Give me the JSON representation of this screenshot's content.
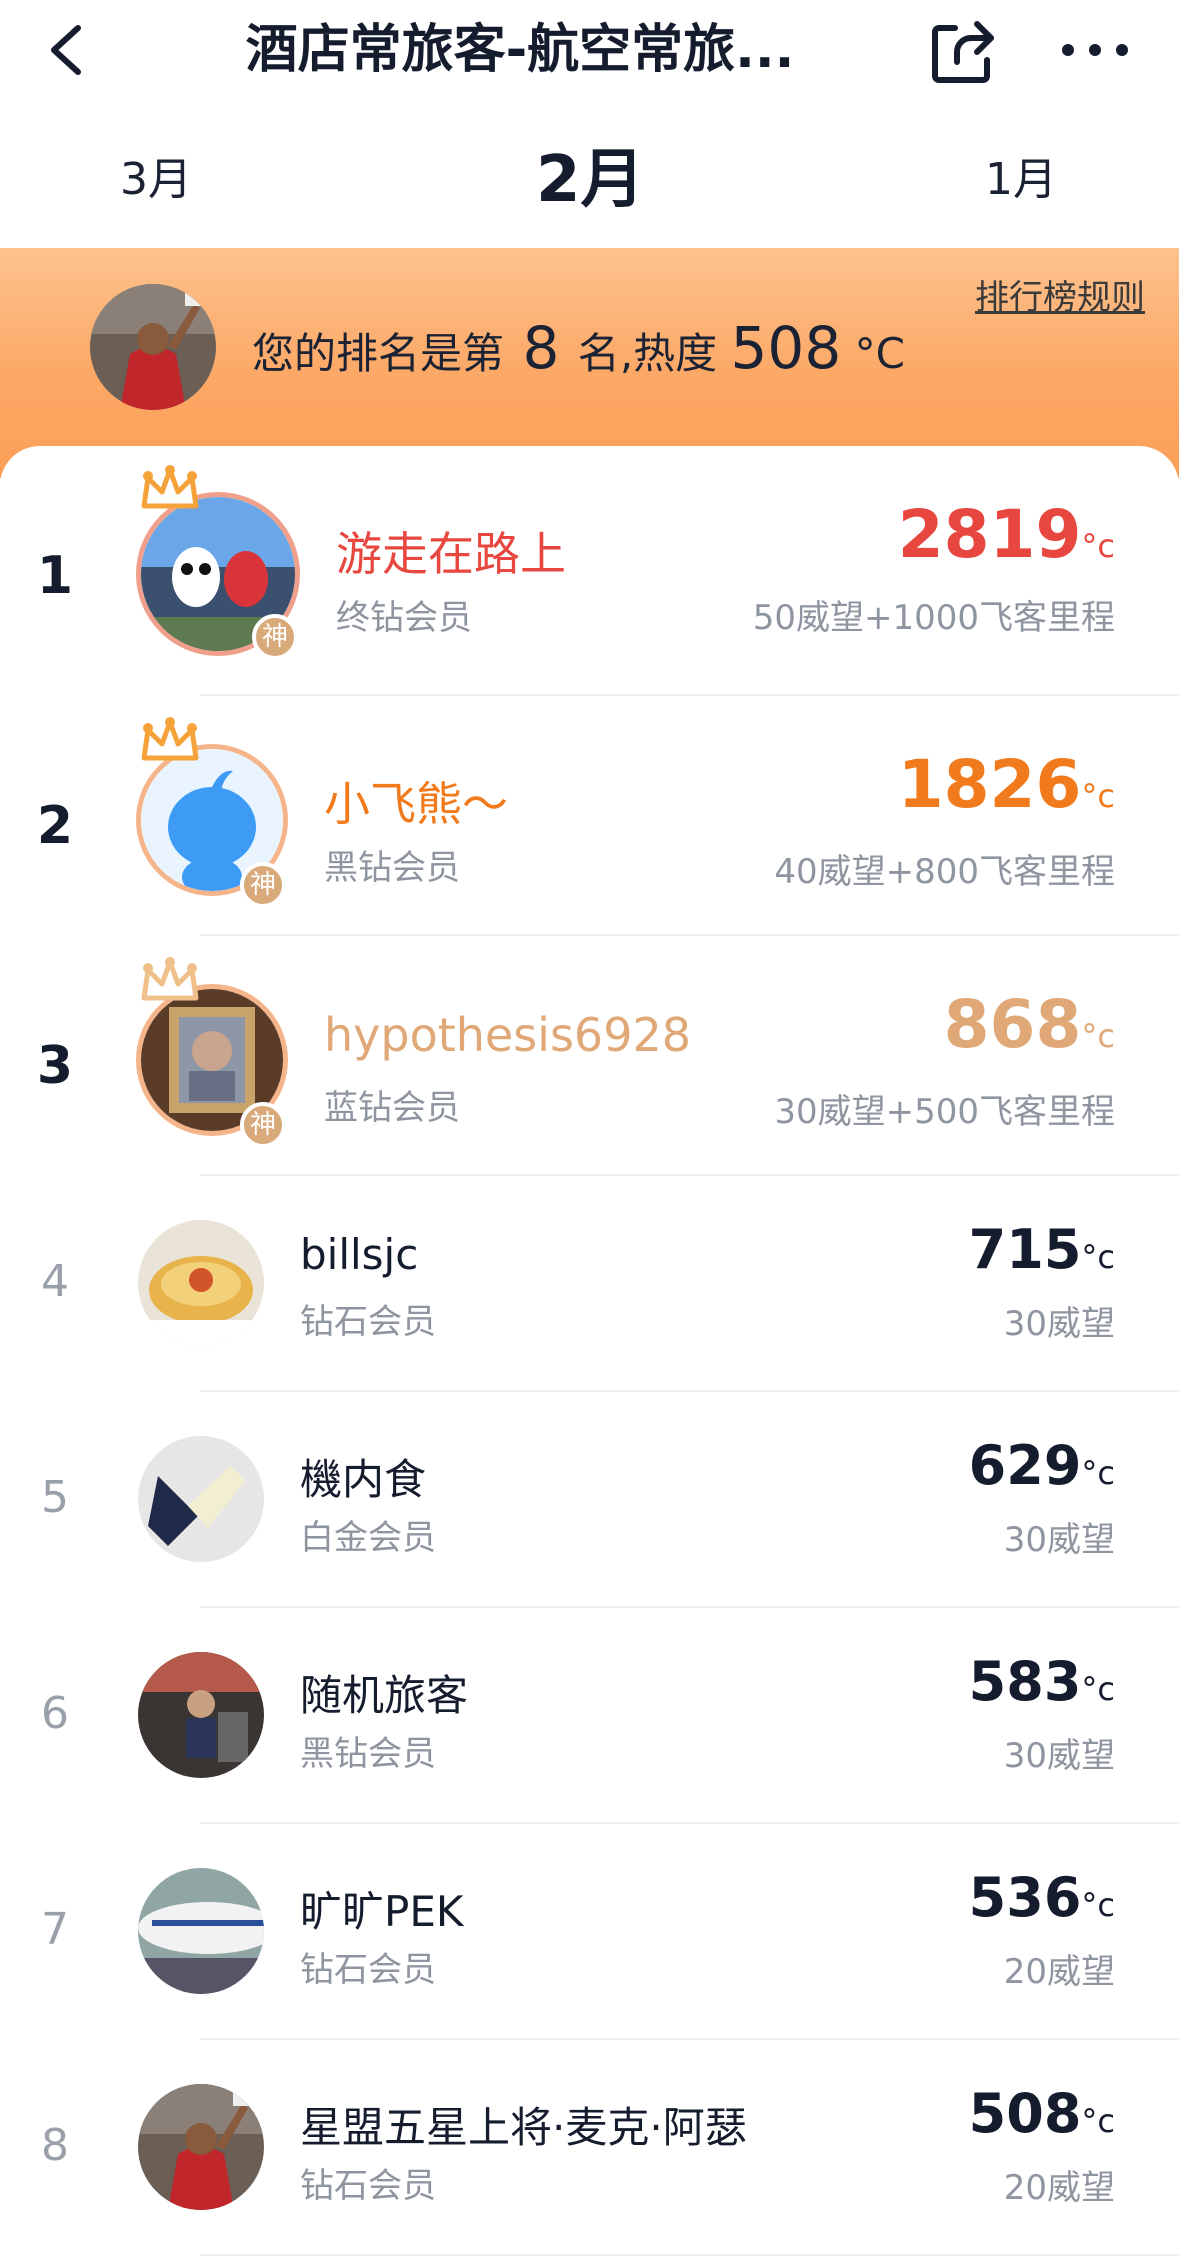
{
  "nav": {
    "title": "酒店常旅客-航空常旅...",
    "back_icon": "chevron-left-icon",
    "share_icon": "share-icon",
    "more_icon": "more-icon"
  },
  "months": {
    "prev": "3月",
    "current": "2月",
    "next": "1月"
  },
  "banner": {
    "prefix": "您的排名是第",
    "rank_word": "第8",
    "rank_suffix": "名",
    "heat_label": ",热度",
    "heat_value": "508",
    "unit": "°C",
    "rules_link": "排行榜规则"
  },
  "colors": {
    "rank1": "#e8473f",
    "rank2": "#f07a1c",
    "rank3": "#e0a877",
    "normal": "#151c2e",
    "banner_orange": "#fca866"
  },
  "list": [
    {
      "rank": "1",
      "name": "游走在路上",
      "level": "终钻会员",
      "heat": "2819",
      "unit": "°c",
      "reward": "50威望+1000飞客里程",
      "badge": "神"
    },
    {
      "rank": "2",
      "name": "小飞熊～",
      "level": "黑钻会员",
      "heat": "1826",
      "unit": "°c",
      "reward": "40威望+800飞客里程",
      "badge": "神"
    },
    {
      "rank": "3",
      "name": "hypothesis6928",
      "level": "蓝钻会员",
      "heat": "868",
      "unit": "°c",
      "reward": "30威望+500飞客里程",
      "badge": "神"
    },
    {
      "rank": "4",
      "name": "billsjc",
      "level": "钻石会员",
      "heat": "715",
      "unit": "°c",
      "reward": "30威望"
    },
    {
      "rank": "5",
      "name": "機内食",
      "level": "白金会员",
      "heat": "629",
      "unit": "°c",
      "reward": "30威望"
    },
    {
      "rank": "6",
      "name": "随机旅客",
      "level": "黑钻会员",
      "heat": "583",
      "unit": "°c",
      "reward": "30威望"
    },
    {
      "rank": "7",
      "name": "旷旷PEK",
      "level": "钻石会员",
      "heat": "536",
      "unit": "°c",
      "reward": "20威望"
    },
    {
      "rank": "8",
      "name": "星盟五星上将·麦克·阿瑟",
      "level": "钻石会员",
      "heat": "508",
      "unit": "°c",
      "reward": "20威望"
    }
  ]
}
